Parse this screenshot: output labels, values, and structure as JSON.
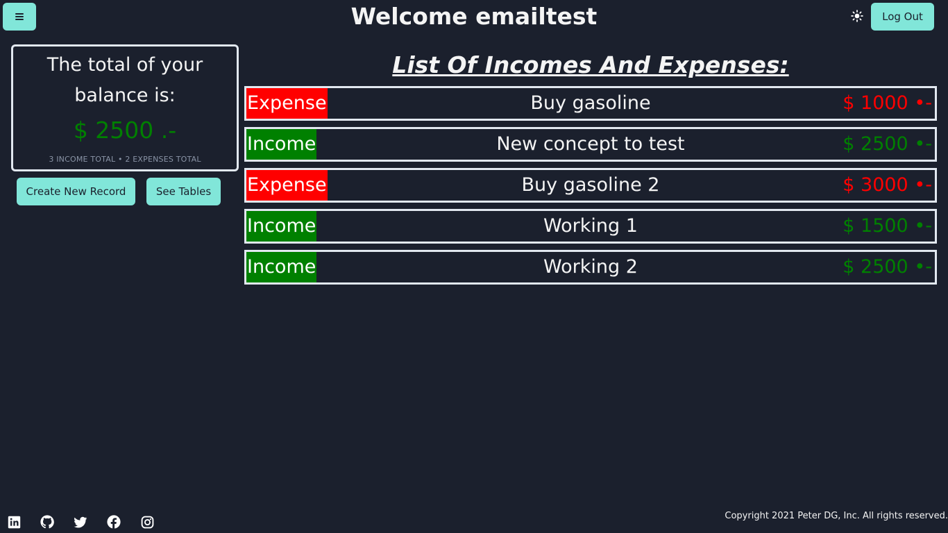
{
  "header": {
    "title": "Welcome emailtest",
    "logout_label": "Log Out",
    "menu_icon": "hamburger-icon",
    "theme_icon": "sun-icon"
  },
  "balance": {
    "heading": "The total of your balance is:",
    "amount": "$ 2500 .-",
    "summary": "3 INCOME TOTAL • 2 EXPENSES TOTAL"
  },
  "actions": {
    "create_label": "Create New Record",
    "tables_label": "See Tables"
  },
  "list": {
    "title": "List Of Incomes And Expenses:",
    "records": [
      {
        "type": "Expense",
        "concept": "Buy gasoline",
        "amount": "$ 1000 •-"
      },
      {
        "type": "Income",
        "concept": "New concept to test",
        "amount": "$ 2500 •-"
      },
      {
        "type": "Expense",
        "concept": "Buy gasoline 2",
        "amount": "$ 3000 •-"
      },
      {
        "type": "Income",
        "concept": "Working 1",
        "amount": "$ 1500 •-"
      },
      {
        "type": "Income",
        "concept": "Working 2",
        "amount": "$ 2500 •-"
      }
    ]
  },
  "footer": {
    "social_icons": [
      "linkedin-icon",
      "github-icon",
      "twitter-icon",
      "facebook-icon",
      "instagram-icon"
    ],
    "copyright": "Copyright 2021 Peter DG, Inc. All rights reserved."
  },
  "colors": {
    "background": "#1b202d",
    "accent": "#81e6d9",
    "income": "#008000",
    "expense": "#ff0000"
  }
}
